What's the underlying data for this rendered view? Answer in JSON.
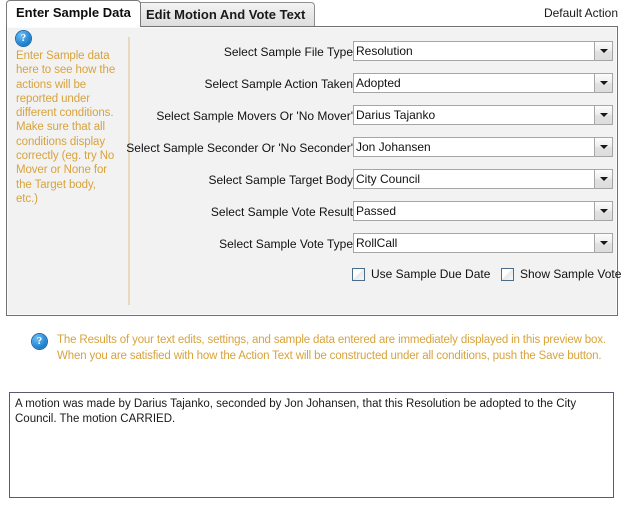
{
  "tabs": [
    {
      "label": "Enter Sample Data",
      "active": true
    },
    {
      "label": "Edit Motion And Vote Text",
      "active": false
    }
  ],
  "header": {
    "default_action_label": "Default Action"
  },
  "sidebar": {
    "icon": "help-question-icon",
    "text": "Enter Sample data here to see how the actions will be reported under different conditions. Make sure that all conditions display correctly (eg. try No Mover or None for the Target body, etc.)"
  },
  "form": {
    "rows": [
      {
        "label": "Select Sample File Type",
        "value": "Resolution"
      },
      {
        "label": "Select Sample Action Taken",
        "value": "Adopted"
      },
      {
        "label": "Select Sample Movers Or 'No Mover'",
        "value": "Darius Tajanko"
      },
      {
        "label": "Select Sample Seconder Or 'No Seconder'",
        "value": "Jon Johansen"
      },
      {
        "label": "Select Sample Target Body",
        "value": "City Council"
      },
      {
        "label": "Select Sample Vote Result",
        "value": "Passed"
      },
      {
        "label": "Select Sample Vote Type",
        "value": "RollCall"
      }
    ],
    "checkboxes": [
      {
        "label": "Use Sample Due Date",
        "checked": false
      },
      {
        "label": "Show Sample Vote",
        "checked": false
      }
    ]
  },
  "lower_help": {
    "icon": "help-question-icon",
    "text": "The Results of your text edits, settings, and sample data entered are immediately displayed in this preview box. When you are satisfied with how the Action Text will be constructed under all conditions, push the Save button."
  },
  "preview": {
    "text": "A motion was made by Darius Tajanko, seconded by Jon Johansen, that this Resolution be adopted to the City Council. The motion CARRIED."
  },
  "icons": {
    "question_mark": "?",
    "dropdown_arrow": "chevron-down-icon"
  },
  "colors": {
    "help_text": "#d8a33c",
    "panel_bg": "#f2f2f2",
    "divider": "#e8d9bd"
  }
}
